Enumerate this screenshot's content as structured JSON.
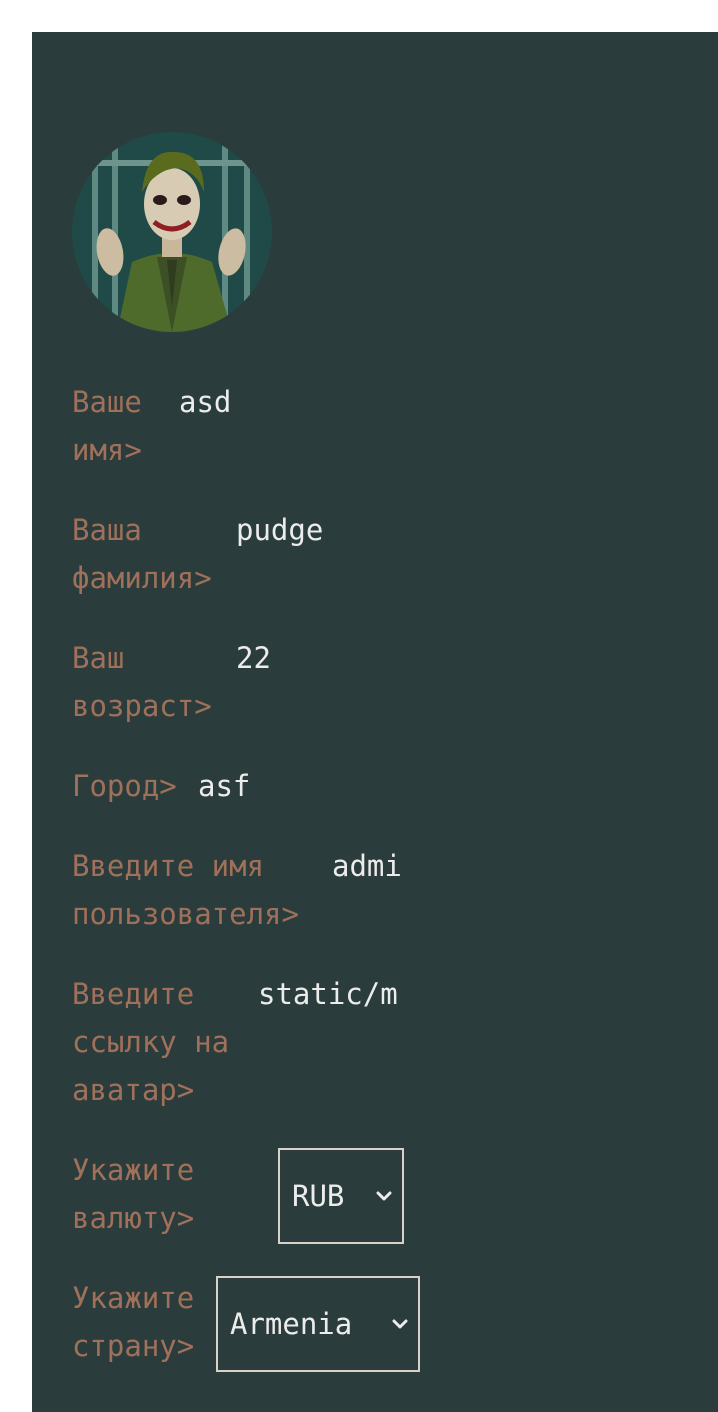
{
  "profile": {
    "avatar_alt": "avatar",
    "fields": [
      {
        "label_line1": "Ваше",
        "label_line2": "имя>",
        "value": "asd"
      },
      {
        "label_line1": "Ваша",
        "label_line2": "фамилия>",
        "value": "pudge"
      },
      {
        "label_line1": "Ваш",
        "label_line2": "возраст>",
        "value": "22"
      },
      {
        "label_line1": "Город>",
        "value": "asf"
      },
      {
        "label_line1": "Введите имя",
        "label_line2": "пользователя>",
        "value": "admi"
      },
      {
        "label_line1": "Введите",
        "label_line2": "ссылку на",
        "label_line3": "аватар>",
        "value": "static/m"
      }
    ],
    "currency": {
      "label_line1": "Укажите",
      "label_line2": "валюту>",
      "selected": "RUB"
    },
    "country": {
      "label_line1": "Укажите",
      "label_line2": "страну>",
      "selected": "Armenia"
    }
  },
  "colors": {
    "panel_bg": "#2a3d3c",
    "label": "#a0705a",
    "value": "#ececec",
    "select_border": "#d9d2c8"
  }
}
